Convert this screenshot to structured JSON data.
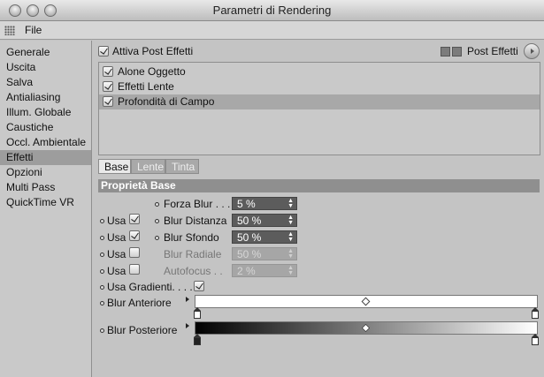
{
  "window": {
    "title": "Parametri di Rendering"
  },
  "menu": {
    "file": "File"
  },
  "sidebar": {
    "items": [
      {
        "label": "Generale"
      },
      {
        "label": "Uscita"
      },
      {
        "label": "Salva"
      },
      {
        "label": "Antialiasing"
      },
      {
        "label": "Illum. Globale"
      },
      {
        "label": "Caustiche"
      },
      {
        "label": "Occl. Ambientale"
      },
      {
        "label": "Effetti",
        "selected": true
      },
      {
        "label": "Opzioni"
      },
      {
        "label": "Multi Pass"
      },
      {
        "label": "QuickTime VR"
      }
    ]
  },
  "header": {
    "activate_label": "Attiva Post Effetti",
    "activate_checked": true,
    "post_effects_label": "Post Effetti"
  },
  "effects": [
    {
      "label": "Alone Oggetto",
      "checked": true
    },
    {
      "label": "Effetti Lente",
      "checked": true
    },
    {
      "label": "Profondità di Campo",
      "checked": true,
      "selected": true
    }
  ],
  "tabs": [
    {
      "label": "Base",
      "active": true
    },
    {
      "label": "Lente"
    },
    {
      "label": "Tinta"
    }
  ],
  "section": {
    "title": "Proprietà Base"
  },
  "params": {
    "use_label": "Usa",
    "forza_blur": {
      "label": "Forza Blur",
      "dots": ". . .",
      "value": "5 %"
    },
    "blur_distanza": {
      "label": "Blur Distanza",
      "value": "50 %",
      "use_checked": true
    },
    "blur_sfondo": {
      "label": "Blur Sfondo",
      "value": "50 %",
      "use_checked": true
    },
    "blur_radiale": {
      "label": "Blur Radiale",
      "value": "50 %",
      "use_checked": false
    },
    "autofocus": {
      "label": "Autofocus",
      "dots": ". .",
      "value": "2 %",
      "use_checked": false
    },
    "usa_gradienti": {
      "label": "Usa Gradienti",
      "dots": ". . . .",
      "checked": true
    },
    "blur_anteriore": {
      "label": "Blur Anteriore"
    },
    "blur_posteriore": {
      "label": "Blur Posteriore"
    }
  },
  "colors": {
    "panel": "#c4c4c4",
    "selection": "#9d9d9d",
    "section_header": "#8f8f8f",
    "field": "#5c5c5c"
  }
}
